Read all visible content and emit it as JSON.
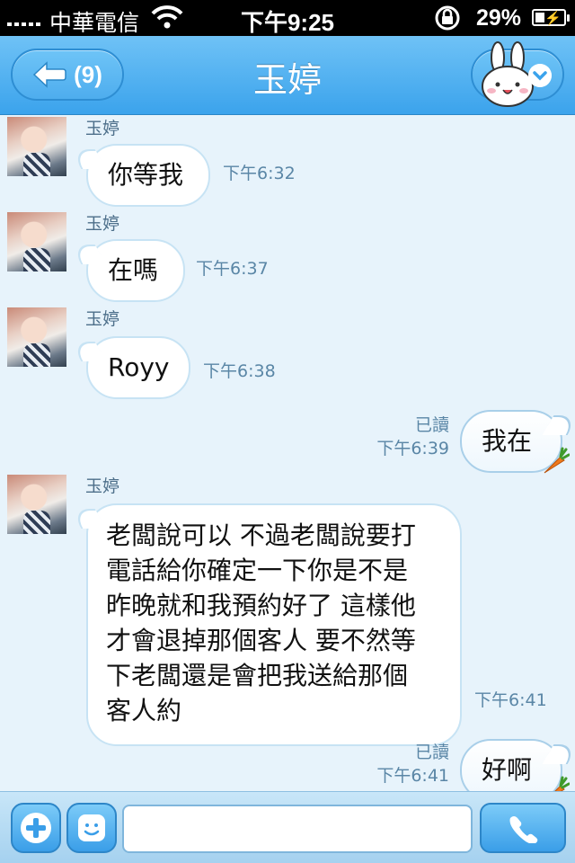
{
  "status_bar": {
    "carrier": "中華電信",
    "time": "下午9:25",
    "battery": "29%"
  },
  "nav": {
    "back_count": "(9)",
    "title": "玉婷"
  },
  "messages": [
    {
      "sender": "玉婷",
      "text": "你等我",
      "time": "下午6:32"
    },
    {
      "sender": "玉婷",
      "text": "在嗎",
      "time": "下午6:37"
    },
    {
      "sender": "玉婷",
      "text": "Royy",
      "time": "下午6:38"
    },
    {
      "read": "已讀",
      "text": "我在",
      "time": "下午6:39"
    },
    {
      "sender": "玉婷",
      "lines": [
        "老闆說可以 不過老闆說要打",
        "電話給你確定一下你是不是",
        "昨晚就和我預約好了 這樣他",
        "才會退掉那個客人 要不然等",
        "下老闆還是會把我送給那個",
        "客人約"
      ],
      "time": "下午6:41"
    },
    {
      "read": "已讀",
      "text": "好啊",
      "time": "下午6:41"
    }
  ],
  "input": {
    "value": "",
    "placeholder": ""
  },
  "icons": {
    "back": "back-arrow-icon",
    "menu": "bunny-menu-icon",
    "add": "plus-icon",
    "emoji": "smiley-icon",
    "call": "phone-icon"
  },
  "colors": {
    "accent": "#3ba3ec",
    "background": "#e7f3fb"
  }
}
